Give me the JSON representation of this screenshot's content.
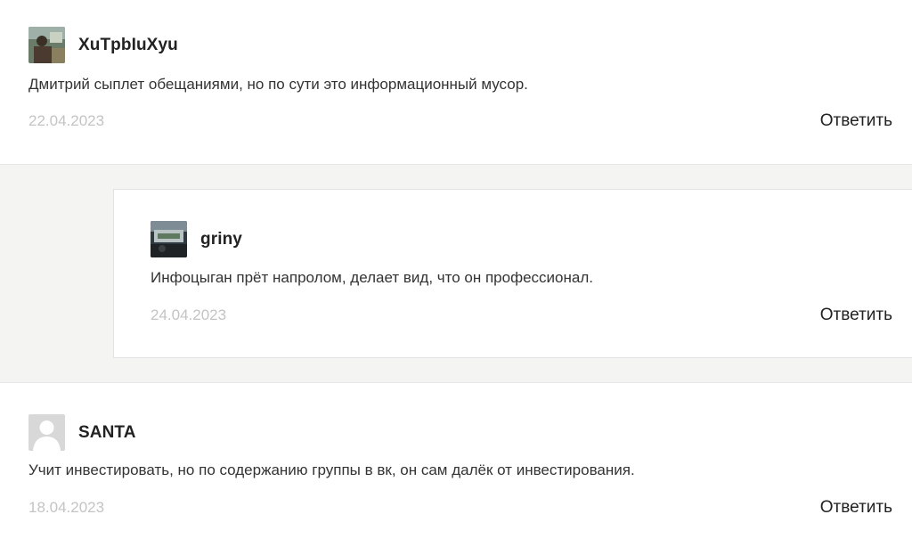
{
  "comments": [
    {
      "author": "XuTpbIuXyu",
      "text": "Дмитрий сыплет обещаниями, но по сути это информационный мусор.",
      "date": "22.04.2023",
      "reply_label": "Ответить",
      "avatar": "photo-avatar"
    },
    {
      "author": "griny",
      "text": "Инфоцыган прёт напролом, делает вид, что он профессионал.",
      "date": "24.04.2023",
      "reply_label": "Ответить",
      "avatar": "photo-avatar"
    },
    {
      "author": "SANTA",
      "text": "Учит инвестировать, но по содержанию группы в вк, он сам далёк от инвестирования.",
      "date": "18.04.2023",
      "reply_label": "Ответить",
      "avatar": "default-user-avatar"
    }
  ],
  "colors": {
    "author": "#222222",
    "text": "#333333",
    "date": "#c4c4c4",
    "reply_background": "#f4f4f2",
    "divider": "#e6e6e6"
  }
}
